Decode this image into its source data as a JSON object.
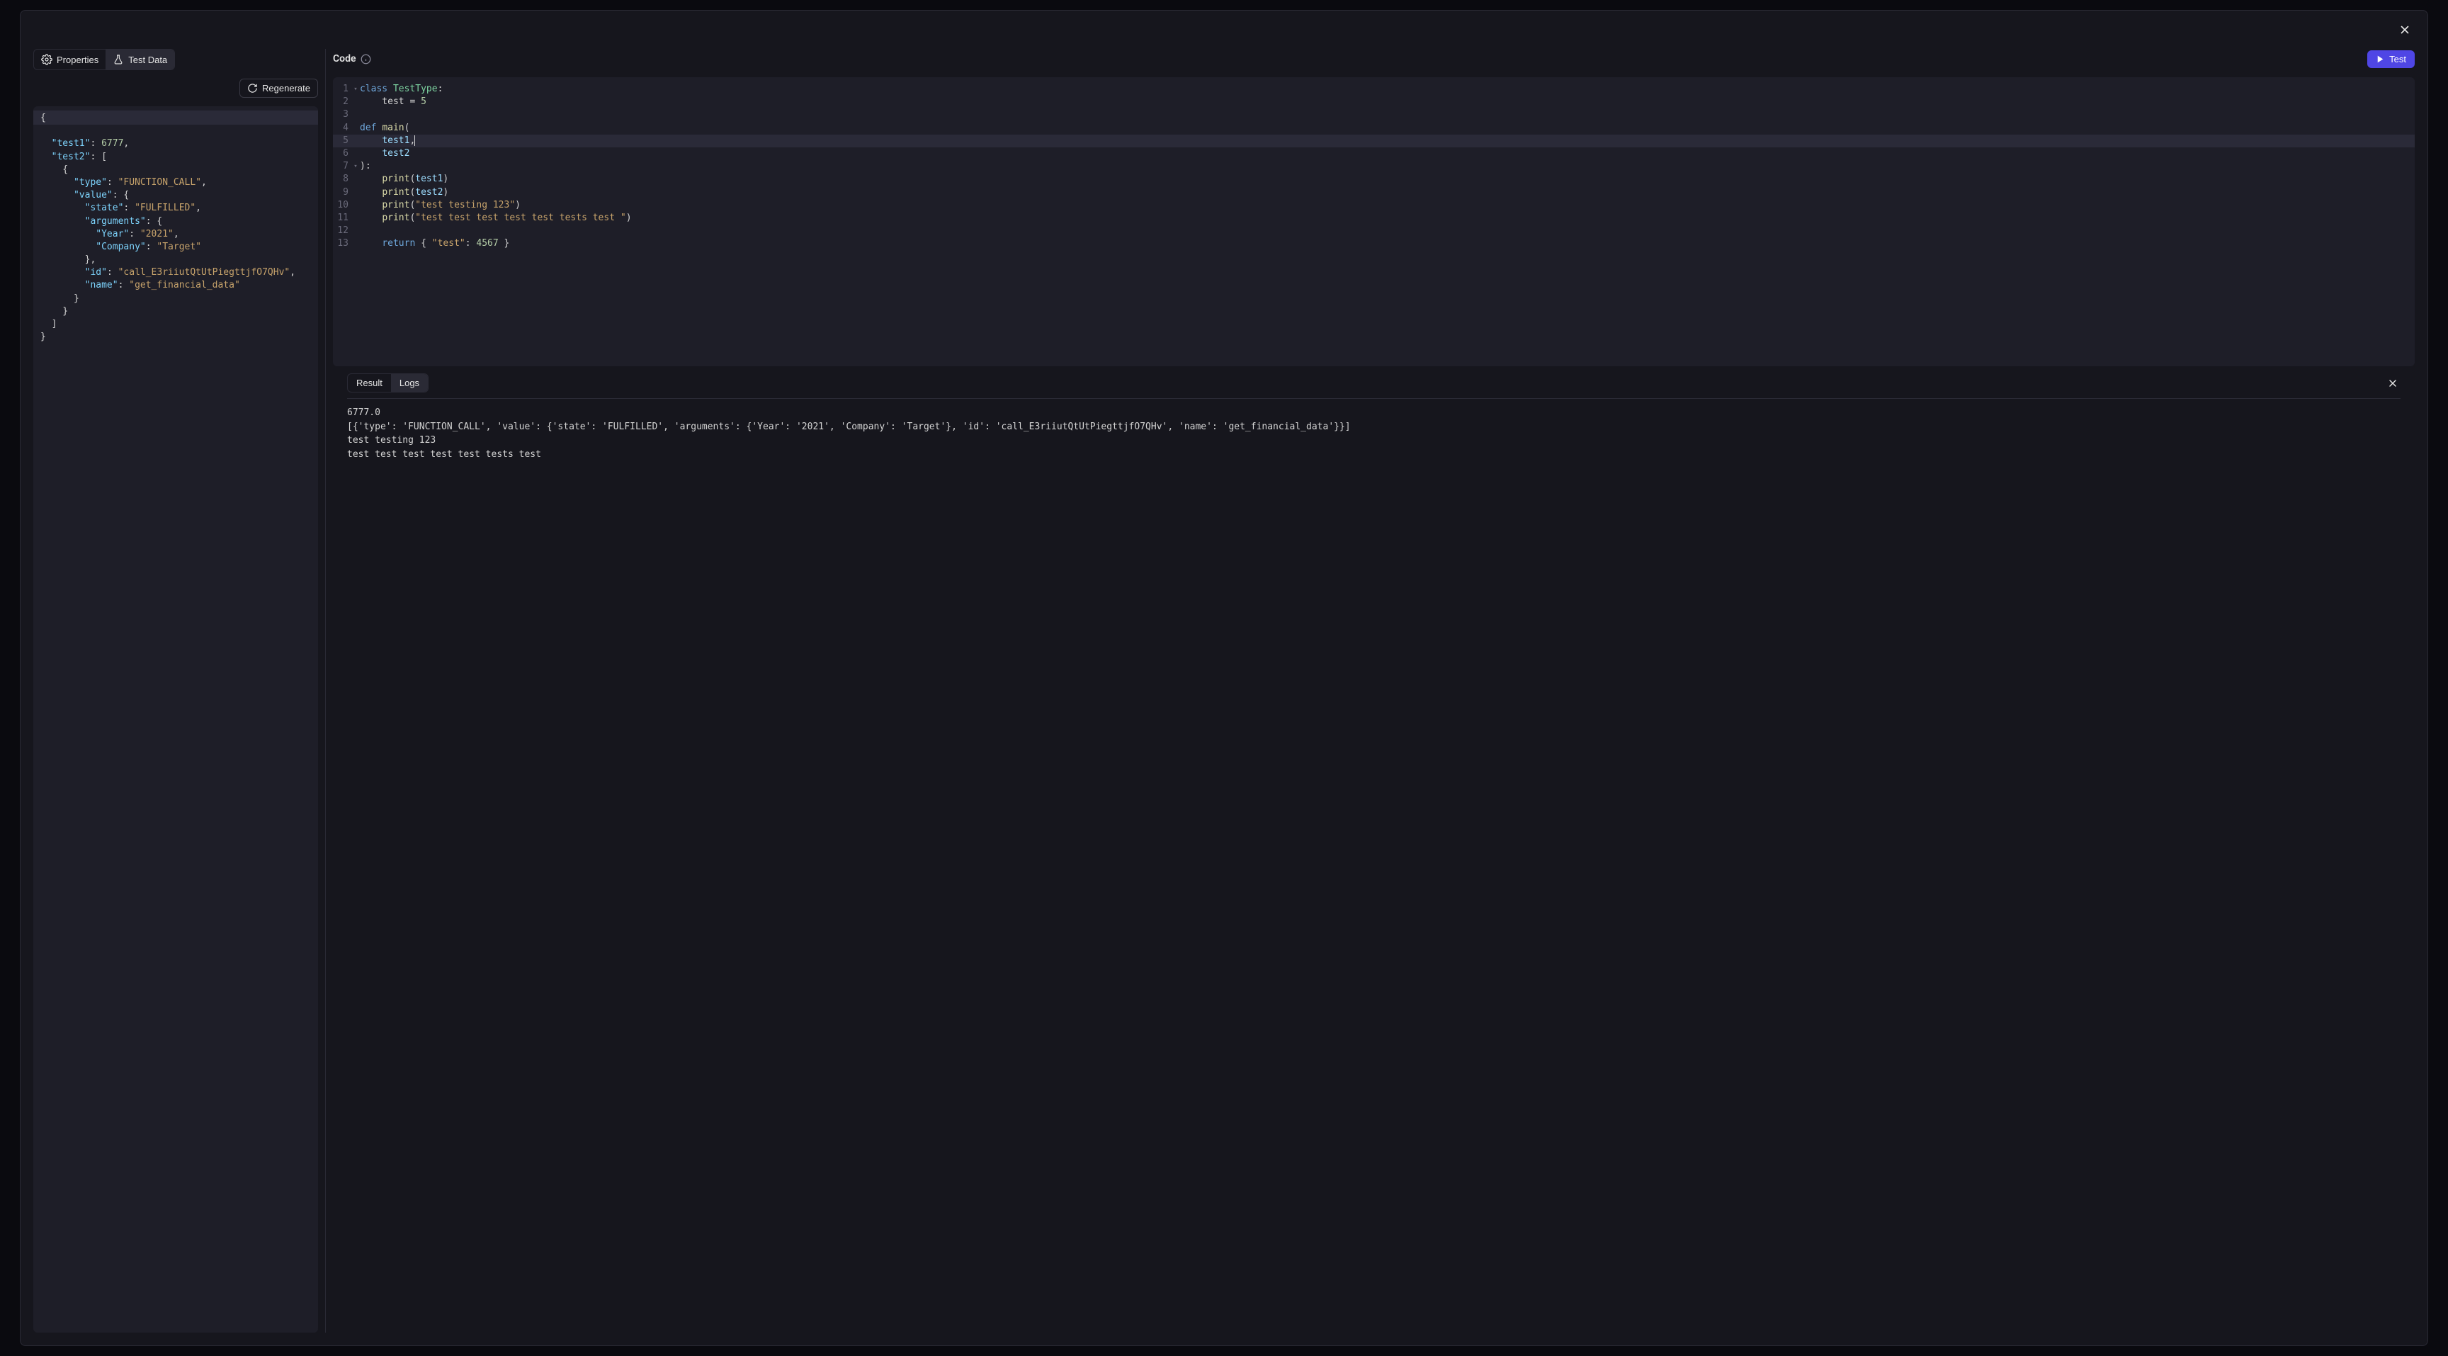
{
  "tabs": {
    "properties": "Properties",
    "test_data": "Test Data"
  },
  "buttons": {
    "regenerate": "Regenerate",
    "test": "Test"
  },
  "labels": {
    "code": "Code"
  },
  "test_data_json": {
    "lines": [
      "{",
      "  \"test1\": 6777,",
      "  \"test2\": [",
      "    {",
      "      \"type\": \"FUNCTION_CALL\",",
      "      \"value\": {",
      "        \"state\": \"FULFILLED\",",
      "        \"arguments\": {",
      "          \"Year\": \"2021\",",
      "          \"Company\": \"Target\"",
      "        },",
      "        \"id\": \"call_E3riiutQtUtPiegttjfO7QHv\",",
      "        \"name\": \"get_financial_data\"",
      "      }",
      "    }",
      "  ]",
      "}"
    ]
  },
  "code": {
    "lines": [
      {
        "n": 1,
        "fold": true,
        "hl": false,
        "tokens": [
          {
            "t": "class ",
            "c": "ctok-kw"
          },
          {
            "t": "TestType",
            "c": "ctok-cls"
          },
          {
            "t": ":",
            "c": "ctok-p"
          }
        ]
      },
      {
        "n": 2,
        "fold": false,
        "hl": false,
        "tokens": [
          {
            "t": "    test ",
            "c": "ctok-p"
          },
          {
            "t": "=",
            "c": "ctok-p"
          },
          {
            "t": " ",
            "c": "ctok-p"
          },
          {
            "t": "5",
            "c": "ctok-num"
          }
        ]
      },
      {
        "n": 3,
        "fold": false,
        "hl": false,
        "tokens": []
      },
      {
        "n": 4,
        "fold": false,
        "hl": false,
        "tokens": [
          {
            "t": "def ",
            "c": "ctok-kw"
          },
          {
            "t": "main",
            "c": "ctok-fn"
          },
          {
            "t": "(",
            "c": "ctok-p"
          }
        ]
      },
      {
        "n": 5,
        "fold": false,
        "hl": true,
        "cursor": true,
        "tokens": [
          {
            "t": "    ",
            "c": "ctok-p"
          },
          {
            "t": "test1",
            "c": "ctok-var"
          },
          {
            "t": ",",
            "c": "ctok-p"
          }
        ]
      },
      {
        "n": 6,
        "fold": false,
        "hl": false,
        "tokens": [
          {
            "t": "    ",
            "c": "ctok-p"
          },
          {
            "t": "test2",
            "c": "ctok-var"
          }
        ]
      },
      {
        "n": 7,
        "fold": true,
        "hl": false,
        "tokens": [
          {
            "t": ")",
            "c": "ctok-p"
          },
          {
            "t": ":",
            "c": "ctok-p"
          }
        ]
      },
      {
        "n": 8,
        "fold": false,
        "hl": false,
        "tokens": [
          {
            "t": "    ",
            "c": "ctok-p"
          },
          {
            "t": "print",
            "c": "ctok-fn"
          },
          {
            "t": "(",
            "c": "ctok-p"
          },
          {
            "t": "test1",
            "c": "ctok-var"
          },
          {
            "t": ")",
            "c": "ctok-p"
          }
        ]
      },
      {
        "n": 9,
        "fold": false,
        "hl": false,
        "tokens": [
          {
            "t": "    ",
            "c": "ctok-p"
          },
          {
            "t": "print",
            "c": "ctok-fn"
          },
          {
            "t": "(",
            "c": "ctok-p"
          },
          {
            "t": "test2",
            "c": "ctok-var"
          },
          {
            "t": ")",
            "c": "ctok-p"
          }
        ]
      },
      {
        "n": 10,
        "fold": false,
        "hl": false,
        "tokens": [
          {
            "t": "    ",
            "c": "ctok-p"
          },
          {
            "t": "print",
            "c": "ctok-fn"
          },
          {
            "t": "(",
            "c": "ctok-p"
          },
          {
            "t": "\"test testing 123\"",
            "c": "ctok-str"
          },
          {
            "t": ")",
            "c": "ctok-p"
          }
        ]
      },
      {
        "n": 11,
        "fold": false,
        "hl": false,
        "tokens": [
          {
            "t": "    ",
            "c": "ctok-p"
          },
          {
            "t": "print",
            "c": "ctok-fn"
          },
          {
            "t": "(",
            "c": "ctok-p"
          },
          {
            "t": "\"test test test test test tests test \"",
            "c": "ctok-str"
          },
          {
            "t": ")",
            "c": "ctok-p"
          }
        ]
      },
      {
        "n": 12,
        "fold": false,
        "hl": false,
        "tokens": []
      },
      {
        "n": 13,
        "fold": false,
        "hl": false,
        "tokens": [
          {
            "t": "    ",
            "c": "ctok-p"
          },
          {
            "t": "return",
            "c": "ctok-kw"
          },
          {
            "t": " { ",
            "c": "ctok-p"
          },
          {
            "t": "\"test\"",
            "c": "ctok-str"
          },
          {
            "t": ": ",
            "c": "ctok-p"
          },
          {
            "t": "4567",
            "c": "ctok-num"
          },
          {
            "t": " }",
            "c": "ctok-p"
          }
        ]
      }
    ]
  },
  "output": {
    "tabs": {
      "result": "Result",
      "logs": "Logs"
    },
    "active_tab": "logs",
    "body": "6777.0\n[{'type': 'FUNCTION_CALL', 'value': {'state': 'FULFILLED', 'arguments': {'Year': '2021', 'Company': 'Target'}, 'id': 'call_E3riiutQtUtPiegttjfO7QHv', 'name': 'get_financial_data'}}]\ntest testing 123\ntest test test test test tests test "
  }
}
